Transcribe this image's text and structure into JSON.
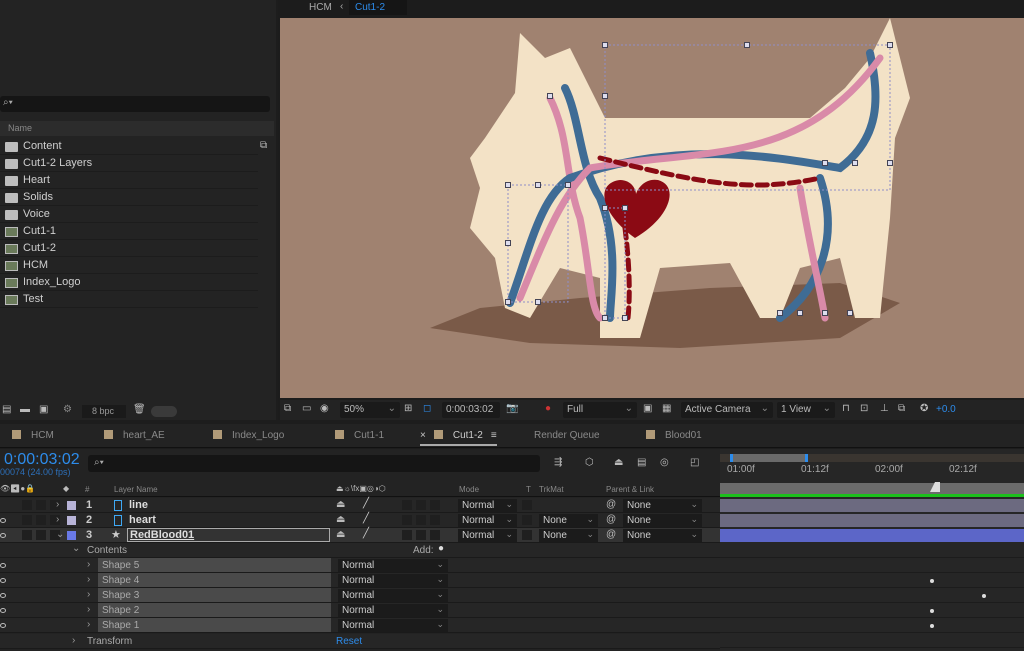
{
  "project": {
    "search_placeholder": "",
    "name_header": "Name",
    "items": [
      {
        "name": "Content",
        "type": "folder"
      },
      {
        "name": "Cut1-2 Layers",
        "type": "folder"
      },
      {
        "name": "Heart",
        "type": "folder"
      },
      {
        "name": "Solids",
        "type": "folder"
      },
      {
        "name": "Voice",
        "type": "folder"
      },
      {
        "name": "Cut1-1",
        "type": "comp"
      },
      {
        "name": "Cut1-2",
        "type": "comp"
      },
      {
        "name": "HCM",
        "type": "comp"
      },
      {
        "name": "Index_Logo",
        "type": "comp"
      },
      {
        "name": "Test",
        "type": "comp"
      }
    ],
    "bpc": "8 bpc"
  },
  "viewer": {
    "breadcrumb": [
      "HCM",
      "Cut1-2"
    ],
    "zoom": "50%",
    "timecode": "0:00:03:02",
    "resolution": "Full",
    "camera": "Active Camera",
    "views": "1 View",
    "exposure": "+0.0",
    "bg_color": "#a08270"
  },
  "tabs": [
    {
      "label": "HCM"
    },
    {
      "label": "heart_AE"
    },
    {
      "label": "Index_Logo"
    },
    {
      "label": "Cut1-1"
    },
    {
      "label": "Cut1-2",
      "active": true
    },
    {
      "label": "Render Queue"
    },
    {
      "label": "Blood01"
    }
  ],
  "timeline": {
    "timecode": "0:00:03:02",
    "frame_info": "00074 (24.00 fps)",
    "headers": {
      "hash": "#",
      "layer_name": "Layer Name",
      "mode": "Mode",
      "t": "T",
      "trkmat": "TrkMat",
      "parent": "Parent & Link"
    },
    "layers": [
      {
        "num": "1",
        "name": "line",
        "mode": "Normal",
        "trkmat": "",
        "parent": "None",
        "color": "#b8b4d8"
      },
      {
        "num": "2",
        "name": "heart",
        "mode": "Normal",
        "trkmat": "None",
        "parent": "None",
        "color": "#b8b4d8"
      },
      {
        "num": "3",
        "name": "RedBlood01",
        "mode": "Normal",
        "trkmat": "None",
        "parent": "None",
        "color": "#6a7ae8"
      }
    ],
    "contents_label": "Contents",
    "add_label": "Add:",
    "shapes": [
      {
        "name": "Shape 5",
        "mode": "Normal"
      },
      {
        "name": "Shape 4",
        "mode": "Normal"
      },
      {
        "name": "Shape 3",
        "mode": "Normal"
      },
      {
        "name": "Shape 2",
        "mode": "Normal"
      },
      {
        "name": "Shape 1",
        "mode": "Normal"
      }
    ],
    "transform_label": "Transform",
    "reset_label": "Reset",
    "ruler": [
      "01:00f",
      "01:12f",
      "02:00f",
      "02:12f"
    ],
    "accent": "#2d8ceb"
  }
}
